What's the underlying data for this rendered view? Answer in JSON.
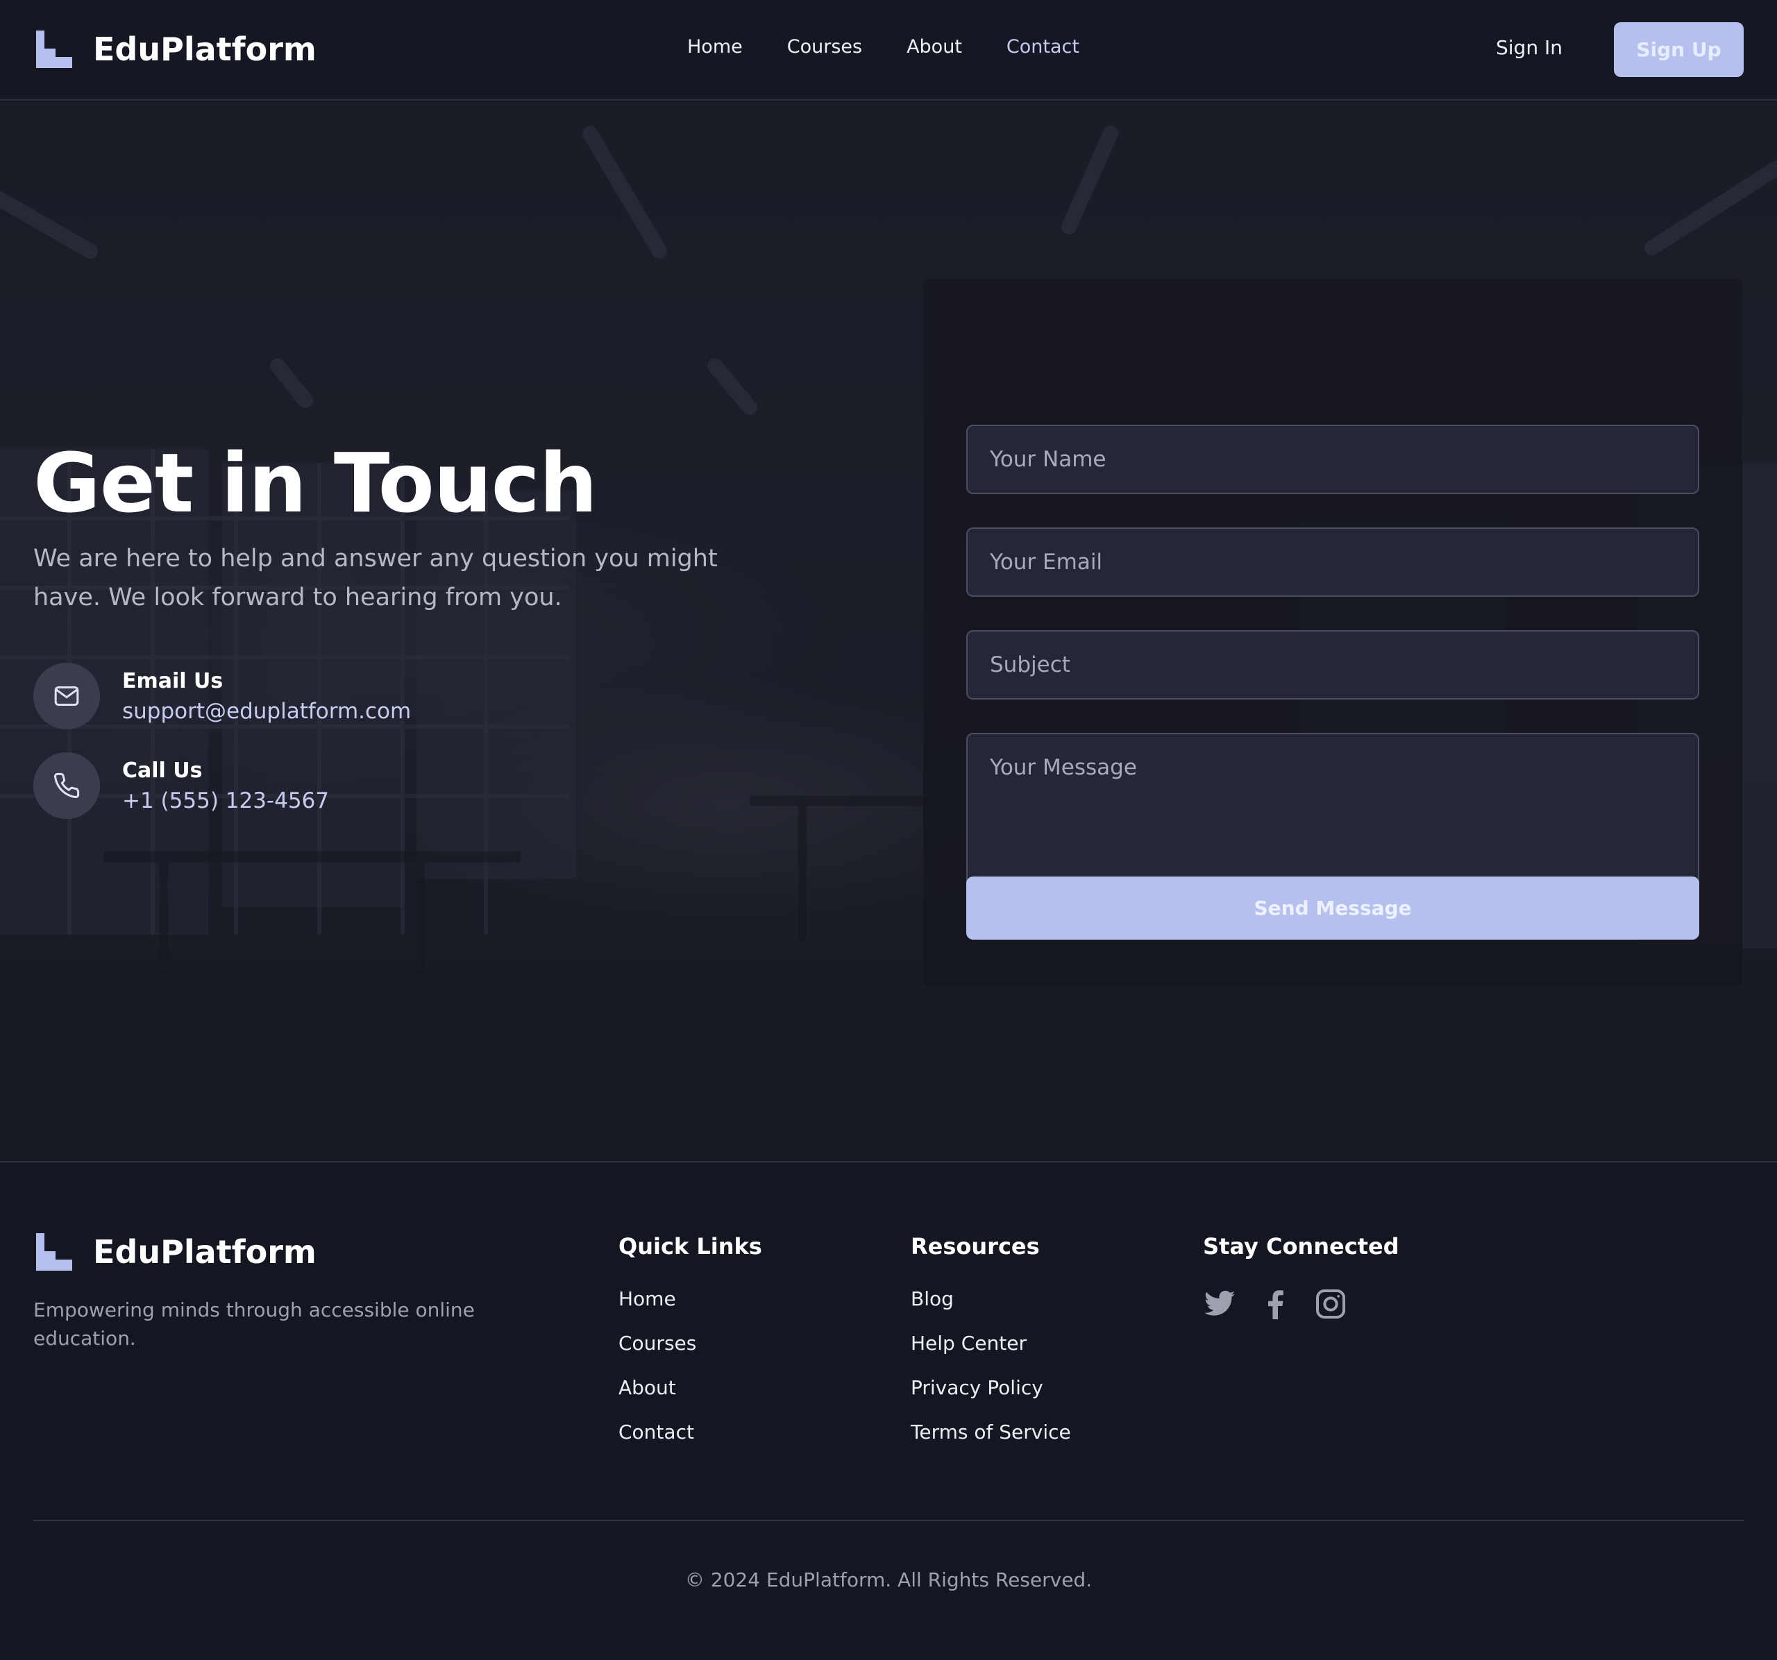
{
  "brand": {
    "name": "EduPlatform",
    "accent": "#b6c0ee"
  },
  "nav": {
    "items": [
      "Home",
      "Courses",
      "About",
      "Contact"
    ],
    "active": "Contact",
    "sign_in": "Sign In",
    "sign_up": "Sign Up"
  },
  "hero": {
    "title": "Get in Touch",
    "subtitle": "We are here to help and answer any question you might have. We look forward to hearing from you.",
    "email": {
      "label": "Email Us",
      "value": "support@eduplatform.com",
      "icon": "mail-icon"
    },
    "phone": {
      "label": "Call Us",
      "value": "+1 (555) 123-4567",
      "icon": "phone-icon"
    }
  },
  "form": {
    "name_placeholder": "Your Name",
    "email_placeholder": "Your Email",
    "subject_placeholder": "Subject",
    "message_placeholder": "Your Message",
    "submit": "Send Message"
  },
  "footer": {
    "tagline": "Empowering minds through accessible online education.",
    "quick_links": {
      "title": "Quick Links",
      "items": [
        "Home",
        "Courses",
        "About",
        "Contact"
      ]
    },
    "resources": {
      "title": "Resources",
      "items": [
        "Blog",
        "Help Center",
        "Privacy Policy",
        "Terms of Service"
      ]
    },
    "social": {
      "title": "Stay Connected",
      "icons": [
        "twitter-icon",
        "facebook-icon",
        "instagram-icon"
      ]
    },
    "copyright": "© 2024 EduPlatform. All Rights Reserved."
  }
}
